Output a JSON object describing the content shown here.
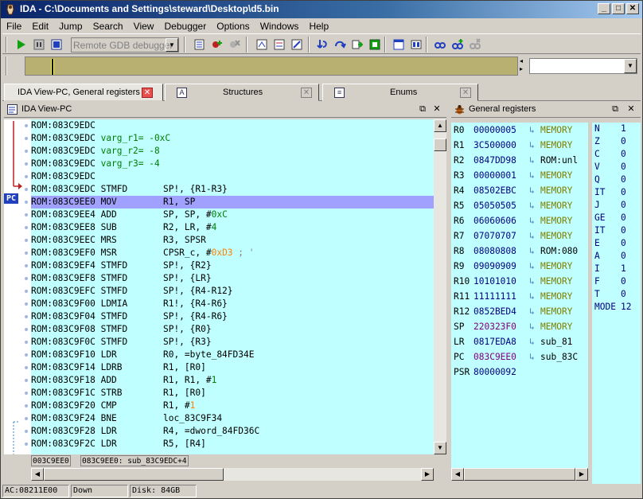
{
  "window": {
    "title": "IDA - C:\\Documents and Settings\\steward\\Desktop\\d5.bin",
    "minimize": "_",
    "maximize": "□",
    "close": "✕"
  },
  "menu": [
    "File",
    "Edit",
    "Jump",
    "Search",
    "View",
    "Debugger",
    "Options",
    "Windows",
    "Help"
  ],
  "toolbar": {
    "debugger_select": "Remote GDB debugger"
  },
  "tabs": [
    {
      "label": "IDA View-PC, General registers",
      "active": true
    },
    {
      "label": "Structures",
      "active": false
    },
    {
      "label": "Enums",
      "active": false
    }
  ],
  "ida_view": {
    "title": "IDA View-PC",
    "pc_marker": "PC",
    "lines": [
      {
        "addr": "ROM:083C9EDC",
        "mn": "",
        "op": ""
      },
      {
        "addr": "ROM:083C9EDC",
        "var": "varg_r1",
        "eq": "= -0xC"
      },
      {
        "addr": "ROM:083C9EDC",
        "var": "varg_r2",
        "eq": "= -8"
      },
      {
        "addr": "ROM:083C9EDC",
        "var": "varg_r3",
        "eq": "= -4"
      },
      {
        "addr": "ROM:083C9EDC",
        "mn": "",
        "op": ""
      },
      {
        "addr": "ROM:083C9EDC",
        "mn": "STMFD",
        "op": "SP!, {R1-R3}"
      },
      {
        "addr": "ROM:083C9EE0",
        "mn": "MOV",
        "op": "R1, SP",
        "selected": true
      },
      {
        "addr": "ROM:083C9EE4",
        "mn": "ADD",
        "op": "SP, SP, #",
        "num": "0xC"
      },
      {
        "addr": "ROM:083C9EE8",
        "mn": "SUB",
        "op": "R2, LR, #",
        "num": "4"
      },
      {
        "addr": "ROM:083C9EEC",
        "mn": "MRS",
        "op": "R3, SPSR"
      },
      {
        "addr": "ROM:083C9EF0",
        "mn": "MSR",
        "op": "CPSR_c, #",
        "hex": "0xD3",
        "cmt": " ; '"
      },
      {
        "addr": "ROM:083C9EF4",
        "mn": "STMFD",
        "op": "SP!, {R2}"
      },
      {
        "addr": "ROM:083C9EF8",
        "mn": "STMFD",
        "op": "SP!, {LR}"
      },
      {
        "addr": "ROM:083C9EFC",
        "mn": "STMFD",
        "op": "SP!, {R4-R12}"
      },
      {
        "addr": "ROM:083C9F00",
        "mn": "LDMIA",
        "op": "R1!, {R4-R6}"
      },
      {
        "addr": "ROM:083C9F04",
        "mn": "STMFD",
        "op": "SP!, {R4-R6}"
      },
      {
        "addr": "ROM:083C9F08",
        "mn": "STMFD",
        "op": "SP!, {R0}"
      },
      {
        "addr": "ROM:083C9F0C",
        "mn": "STMFD",
        "op": "SP!, {R3}"
      },
      {
        "addr": "ROM:083C9F10",
        "mn": "LDR",
        "op": "R0, =byte_84FD34E"
      },
      {
        "addr": "ROM:083C9F14",
        "mn": "LDRB",
        "op": "R1, [R0]"
      },
      {
        "addr": "ROM:083C9F18",
        "mn": "ADD",
        "op": "R1, R1, #",
        "num": "1"
      },
      {
        "addr": "ROM:083C9F1C",
        "mn": "STRB",
        "op": "R1, [R0]"
      },
      {
        "addr": "ROM:083C9F20",
        "mn": "CMP",
        "op": "R1, #",
        "hex": "1"
      },
      {
        "addr": "ROM:083C9F24",
        "mn": "BNE",
        "op": "loc_83C9F34"
      },
      {
        "addr": "ROM:083C9F28",
        "mn": "LDR",
        "op": "R4, =dword_84FD36C"
      },
      {
        "addr": "ROM:083C9F2C",
        "mn": "LDR",
        "op": "R5, [R4]"
      }
    ],
    "status_left": "003C9EE0",
    "status_right": "083C9EE0: sub_83C9EDC+4"
  },
  "registers": {
    "title": "General registers",
    "rows": [
      {
        "name": "R0",
        "value": "00000005",
        "ref": "MEMORY",
        "kind": "mem"
      },
      {
        "name": "R1",
        "value": "3C500000",
        "ref": "MEMORY",
        "kind": "mem"
      },
      {
        "name": "R2",
        "value": "0847DD98",
        "ref": "ROM:unl",
        "kind": "sym"
      },
      {
        "name": "R3",
        "value": "00000001",
        "ref": "MEMORY",
        "kind": "mem"
      },
      {
        "name": "R4",
        "value": "08502EBC",
        "ref": "MEMORY",
        "kind": "mem"
      },
      {
        "name": "R5",
        "value": "05050505",
        "ref": "MEMORY",
        "kind": "mem"
      },
      {
        "name": "R6",
        "value": "06060606",
        "ref": "MEMORY",
        "kind": "mem"
      },
      {
        "name": "R7",
        "value": "07070707",
        "ref": "MEMORY",
        "kind": "mem"
      },
      {
        "name": "R8",
        "value": "08080808",
        "ref": "ROM:080",
        "kind": "sym"
      },
      {
        "name": "R9",
        "value": "09090909",
        "ref": "MEMORY",
        "kind": "mem"
      },
      {
        "name": "R10",
        "value": "10101010",
        "ref": "MEMORY",
        "kind": "mem"
      },
      {
        "name": "R11",
        "value": "11111111",
        "ref": "MEMORY",
        "kind": "mem"
      },
      {
        "name": "R12",
        "value": "0852BED4",
        "ref": "MEMORY",
        "kind": "mem"
      },
      {
        "name": "SP",
        "value": "220323F0",
        "ref": "MEMORY",
        "kind": "mem",
        "changed": true
      },
      {
        "name": "LR",
        "value": "0817EDA8",
        "ref": "sub_81",
        "kind": "sym"
      },
      {
        "name": "PC",
        "value": "083C9EE0",
        "ref": "sub_83C",
        "kind": "sym",
        "changed": true
      },
      {
        "name": "PSR",
        "value": "80000092",
        "ref": "",
        "kind": ""
      }
    ],
    "flags": [
      {
        "name": "N",
        "value": "1"
      },
      {
        "name": "Z",
        "value": "0"
      },
      {
        "name": "C",
        "value": "0"
      },
      {
        "name": "V",
        "value": "0"
      },
      {
        "name": "Q",
        "value": "0"
      },
      {
        "name": "IT",
        "value": "0"
      },
      {
        "name": "J",
        "value": "0"
      },
      {
        "name": "GE",
        "value": "0"
      },
      {
        "name": "IT",
        "value": "0"
      },
      {
        "name": "E",
        "value": "0"
      },
      {
        "name": "A",
        "value": "0"
      },
      {
        "name": "I",
        "value": "1"
      },
      {
        "name": "F",
        "value": "0"
      },
      {
        "name": "T",
        "value": "0"
      },
      {
        "name": "MODE",
        "value": "12"
      }
    ]
  },
  "status": {
    "address": "AC:08211E00",
    "direction": "Down",
    "disk": "Disk: 84GB"
  }
}
